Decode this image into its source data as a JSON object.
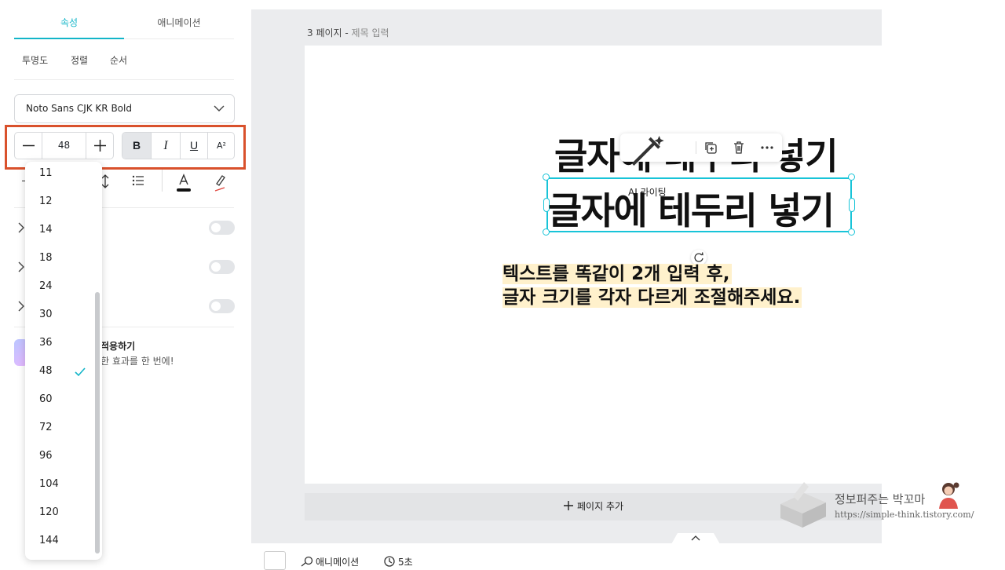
{
  "panel": {
    "tabs": [
      {
        "label": "속성",
        "active": true
      },
      {
        "label": "애니메이션",
        "active": false
      }
    ],
    "subtabs": [
      "투명도",
      "정렬",
      "순서"
    ],
    "font_family": "Noto Sans CJK KR Bold",
    "font_size": "48",
    "format_buttons": [
      {
        "name": "bold",
        "label": "B",
        "active": true
      },
      {
        "name": "italic",
        "label": "I",
        "active": false
      },
      {
        "name": "underline",
        "label": "U",
        "active": false
      },
      {
        "name": "superscript",
        "label": "A²",
        "active": false
      }
    ],
    "ai_effect": {
      "title": "적용하기",
      "desc": "한 효과를 한 번에!"
    }
  },
  "size_dropdown": {
    "options": [
      "11",
      "12",
      "14",
      "18",
      "24",
      "30",
      "36",
      "48",
      "60",
      "72",
      "96",
      "104",
      "120",
      "144"
    ],
    "selected": "48"
  },
  "canvas": {
    "page_label": "3 페이지 -",
    "page_title_placeholder": "제목 입력",
    "headline_top": "글자에 테두리 넣기",
    "headline_selected": "글자에 테두리 넣기",
    "note_line1": "텍스트를 똑같이 2개 입력 후,",
    "note_line2": "글자 크기를 각자 다르게 조절해주세요.",
    "float_toolbar": {
      "ai_label": "AI 라이팅"
    },
    "add_page": "페이지 추가"
  },
  "bottom": {
    "animation": "애니메이션",
    "duration": "5초"
  },
  "watermark": {
    "name": "정보퍼주는 박꼬마",
    "url": "https://simple-think.tistory.com/"
  },
  "colors": {
    "accent": "#13b5c8",
    "selection": "#18c4d8",
    "highlight": "#fff1cc",
    "annotation": "#d9512c"
  }
}
